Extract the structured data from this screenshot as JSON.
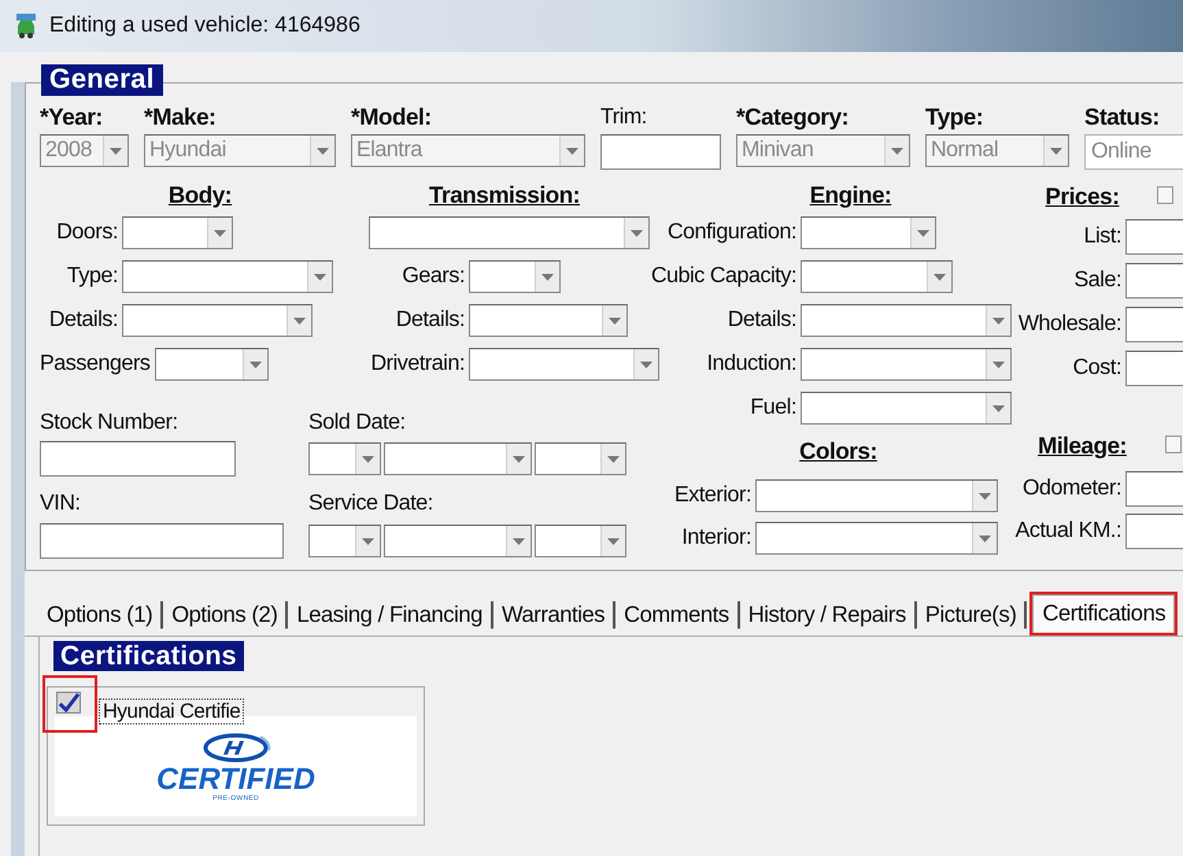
{
  "window": {
    "title": "Editing a used vehicle: 4164986"
  },
  "general": {
    "title": "General",
    "top_fields": [
      {
        "label": "*Year:",
        "bold": true,
        "kind": "combo",
        "value": "2008",
        "disabled": true
      },
      {
        "label": "*Make:",
        "bold": true,
        "kind": "combo",
        "value": "Hyundai",
        "disabled": true
      },
      {
        "label": "*Model:",
        "bold": true,
        "kind": "combo",
        "value": "Elantra",
        "disabled": true
      },
      {
        "label": "Trim:",
        "bold": false,
        "kind": "text",
        "disabled": false
      },
      {
        "label": "*Category:",
        "bold": true,
        "kind": "combo",
        "value": "Minivan",
        "disabled": true
      },
      {
        "label": "Type:",
        "bold": true,
        "kind": "combo",
        "value": "Normal",
        "disabled": true
      },
      {
        "label": "Status:",
        "bold": true,
        "kind": "text",
        "value": "Online",
        "disabled": true
      }
    ],
    "body": {
      "title": "Body:",
      "rows": [
        {
          "label": "Doors:",
          "kind": "combo"
        },
        {
          "label": "Type:",
          "kind": "combo"
        },
        {
          "label": "Details:",
          "kind": "combo"
        },
        {
          "label": "Passengers",
          "kind": "combo"
        }
      ]
    },
    "transmission": {
      "title": "Transmission:",
      "rows": [
        {
          "kind": "combo"
        },
        {
          "label": "Gears:",
          "kind": "combo"
        },
        {
          "label": "Details:",
          "kind": "combo"
        },
        {
          "label": "Drivetrain:",
          "kind": "combo"
        }
      ]
    },
    "engine": {
      "title": "Engine:",
      "rows": [
        {
          "label": "Configuration:",
          "kind": "combo"
        },
        {
          "label": "Cubic Capacity:",
          "kind": "combo"
        },
        {
          "label": "Details:",
          "kind": "combo"
        },
        {
          "label": "Induction:",
          "kind": "combo"
        },
        {
          "label": "Fuel:",
          "kind": "combo"
        }
      ]
    },
    "prices": {
      "title": "Prices:",
      "rows": [
        {
          "label": "List:",
          "kind": "text"
        },
        {
          "label": "Sale:",
          "kind": "text"
        },
        {
          "label": "Wholesale:",
          "kind": "text"
        },
        {
          "label": "Cost:",
          "kind": "text"
        }
      ]
    },
    "stock_number": {
      "label": "Stock Number:"
    },
    "vin": {
      "label": "VIN:"
    },
    "sold_date": {
      "label": "Sold Date:"
    },
    "service_date": {
      "label": "Service Date:"
    },
    "colors": {
      "title": "Colors:",
      "rows": [
        {
          "label": "Exterior:",
          "kind": "combo"
        },
        {
          "label": "Interior:",
          "kind": "combo"
        }
      ]
    },
    "mileage": {
      "title": "Mileage:",
      "rows": [
        {
          "label": "Odometer:",
          "kind": "text"
        },
        {
          "label": "Actual KM.:",
          "kind": "text"
        }
      ]
    }
  },
  "tabs": [
    {
      "label": "Options (1)",
      "selected": false,
      "highlighted": false
    },
    {
      "label": "Options (2)",
      "selected": false,
      "highlighted": false
    },
    {
      "label": "Leasing / Financing",
      "selected": false,
      "highlighted": false
    },
    {
      "label": "Warranties",
      "selected": false,
      "highlighted": false
    },
    {
      "label": "Comments",
      "selected": false,
      "highlighted": false
    },
    {
      "label": "History / Repairs",
      "selected": false,
      "highlighted": false
    },
    {
      "label": "Picture(s)",
      "selected": false,
      "highlighted": false
    },
    {
      "label": "Certifications",
      "selected": true,
      "highlighted": true
    }
  ],
  "certifications": {
    "title": "Certifications",
    "items": [
      {
        "label": "Hyundai Certifie",
        "checked": true,
        "highlighted": true,
        "logo": {
          "text": "CERTIFIED",
          "subtext": "PRE-OWNED"
        }
      }
    ]
  }
}
